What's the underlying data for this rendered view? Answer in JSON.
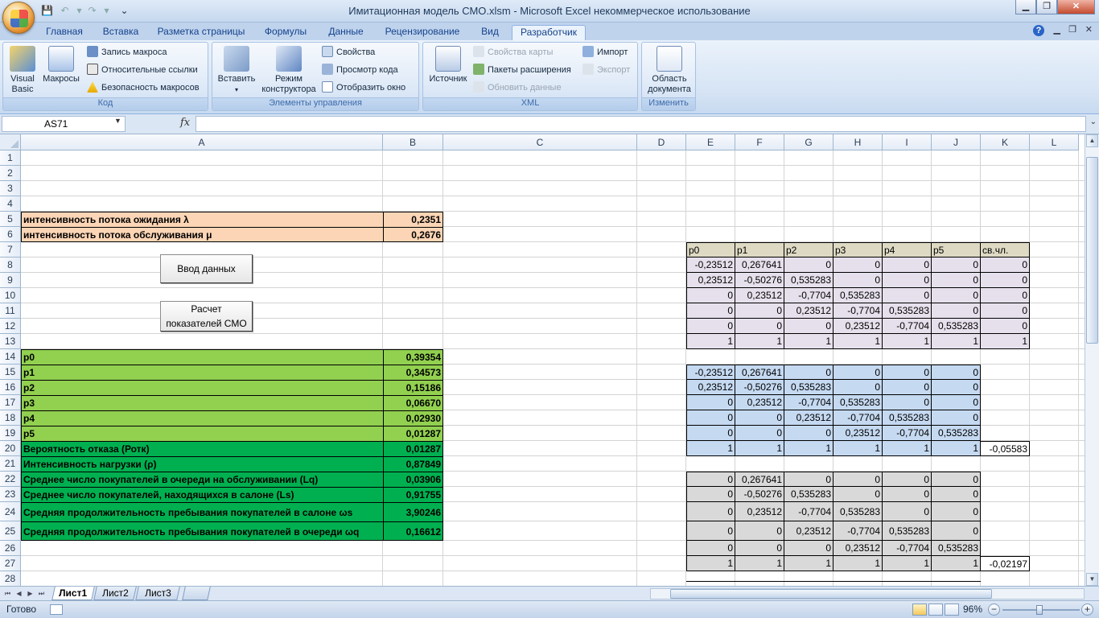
{
  "title": "Имитационная модель СМО.xlsm - Microsoft Excel некоммерческое использование",
  "tabs": [
    "Главная",
    "Вставка",
    "Разметка страницы",
    "Формулы",
    "Данные",
    "Рецензирование",
    "Вид",
    "Разработчик"
  ],
  "active_tab": "Разработчик",
  "ribbon": {
    "kod": {
      "label": "Код",
      "visual_basic": "Visual Basic",
      "macros": "Макросы",
      "record_macro": "Запись макроса",
      "relative_refs": "Относительные ссылки",
      "macro_security": "Безопасность макросов"
    },
    "controls": {
      "label": "Элементы управления",
      "insert": "Вставить",
      "design_mode": "Режим конструктора",
      "properties": "Свойства",
      "view_code": "Просмотр кода",
      "show_window": "Отобразить окно"
    },
    "xml": {
      "label": "XML",
      "source": "Источник",
      "map_props": "Свойства карты",
      "ext_packs": "Пакеты расширения",
      "refresh": "Обновить данные",
      "import": "Импорт",
      "export": "Экспорт"
    },
    "modify": {
      "label": "Изменить",
      "doc_panel": "Область документа"
    }
  },
  "namebox": "AS71",
  "formula": "",
  "columns": [
    "A",
    "B",
    "C",
    "D",
    "E",
    "F",
    "G",
    "H",
    "I",
    "J",
    "K",
    "L"
  ],
  "rows": [
    "1",
    "2",
    "3",
    "4",
    "5",
    "6",
    "7",
    "8",
    "9",
    "10",
    "11",
    "12",
    "13",
    "14",
    "15",
    "16",
    "17",
    "18",
    "19",
    "20",
    "21",
    "22",
    "23",
    "24",
    "25",
    "26",
    "27",
    "28"
  ],
  "inputs": [
    {
      "label": "интенсивность потока ожидания λ",
      "value": "0,2351"
    },
    {
      "label": "интенсивность потока обслуживания μ",
      "value": "0,2676"
    }
  ],
  "buttons": {
    "input_data": "Ввод данных",
    "calc_line1": "Расчет",
    "calc_line2": "показателей СМО"
  },
  "results": [
    {
      "label": "p0",
      "value": "0,39354"
    },
    {
      "label": "p1",
      "value": "0,34573"
    },
    {
      "label": "p2",
      "value": "0,15186"
    },
    {
      "label": "p3",
      "value": "0,06670"
    },
    {
      "label": "p4",
      "value": "0,02930"
    },
    {
      "label": "p5",
      "value": "0,01287"
    },
    {
      "label": "Вероятность отказа (Ротк)",
      "value": "0,01287"
    },
    {
      "label": "Интенсивность нагрузки (ρ)",
      "value": "0,87849"
    },
    {
      "label": "Среднее число покупателей в очереди на обслуживании (Lq)",
      "value": "0,03906"
    },
    {
      "label": "Среднее число покупателей, находящихся в салоне (Ls)",
      "value": "0,91755"
    },
    {
      "label": "Средняя продолжительность пребывания покупателей в салоне ωs",
      "value": "3,90246"
    },
    {
      "label": "Средняя продолжительность пребывания покупателей в очереди ωq",
      "value": "0,16612"
    }
  ],
  "matrix_header": [
    "p0",
    "p1",
    "p2",
    "p3",
    "p4",
    "p5",
    "св.чл."
  ],
  "matrix1": [
    [
      "-0,23512",
      "0,267641",
      "0",
      "0",
      "0",
      "0",
      "0"
    ],
    [
      "0,23512",
      "-0,50276",
      "0,535283",
      "0",
      "0",
      "0",
      "0"
    ],
    [
      "0",
      "0,23512",
      "-0,7704",
      "0,535283",
      "0",
      "0",
      "0"
    ],
    [
      "0",
      "0",
      "0,23512",
      "-0,7704",
      "0,535283",
      "0",
      "0"
    ],
    [
      "0",
      "0",
      "0",
      "0,23512",
      "-0,7704",
      "0,535283",
      "0"
    ],
    [
      "1",
      "1",
      "1",
      "1",
      "1",
      "1",
      "1"
    ]
  ],
  "matrix2": [
    [
      "-0,23512",
      "0,267641",
      "0",
      "0",
      "0",
      "0"
    ],
    [
      "0,23512",
      "-0,50276",
      "0,535283",
      "0",
      "0",
      "0"
    ],
    [
      "0",
      "0,23512",
      "-0,7704",
      "0,535283",
      "0",
      "0"
    ],
    [
      "0",
      "0",
      "0,23512",
      "-0,7704",
      "0,535283",
      "0"
    ],
    [
      "0",
      "0",
      "0",
      "0,23512",
      "-0,7704",
      "0,535283"
    ],
    [
      "1",
      "1",
      "1",
      "1",
      "1",
      "1"
    ]
  ],
  "matrix2_det": "-0,05583",
  "matrix3": [
    [
      "0",
      "0,267641",
      "0",
      "0",
      "0",
      "0"
    ],
    [
      "0",
      "-0,50276",
      "0,535283",
      "0",
      "0",
      "0"
    ],
    [
      "0",
      "0,23512",
      "-0,7704",
      "0,535283",
      "0",
      "0"
    ],
    [
      "0",
      "0",
      "0,23512",
      "-0,7704",
      "0,535283",
      "0"
    ],
    [
      "0",
      "0",
      "0",
      "0,23512",
      "-0,7704",
      "0,535283"
    ],
    [
      "1",
      "1",
      "1",
      "1",
      "1",
      "1"
    ]
  ],
  "matrix3_det": "-0,02197",
  "sheets": [
    "Лист1",
    "Лист2",
    "Лист3"
  ],
  "status": "Готово",
  "zoom": "96%",
  "colors": {
    "peach": "#fbd5b5",
    "light_green": "#92d050",
    "green": "#00b050",
    "tan": "#ddd9c3",
    "lavender": "#e6e0ec",
    "blue": "#c5d9f1",
    "gray": "#d9d9d9"
  }
}
